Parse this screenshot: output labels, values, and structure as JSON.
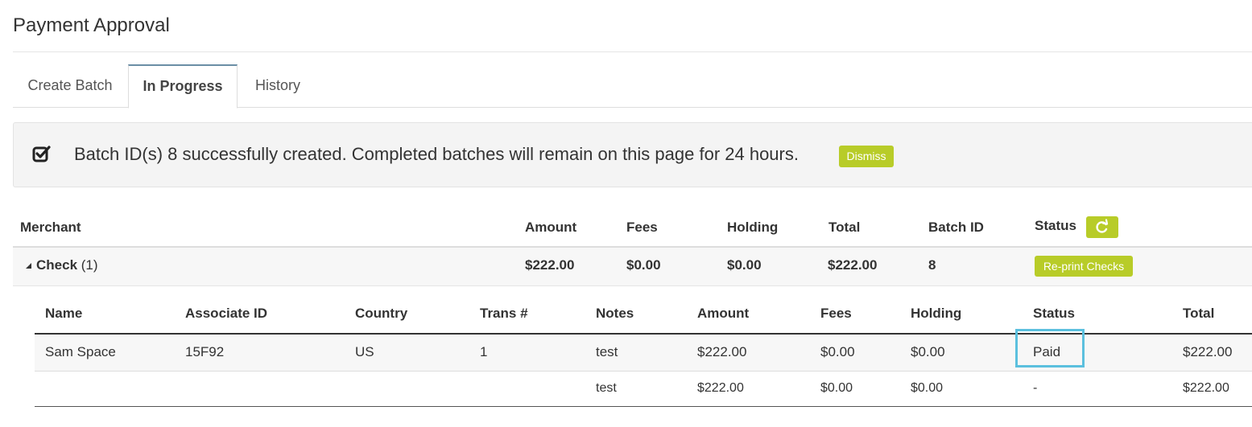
{
  "page": {
    "title": "Payment Approval"
  },
  "tabs": [
    {
      "label": "Create Batch",
      "active": false
    },
    {
      "label": "In Progress",
      "active": true
    },
    {
      "label": "History",
      "active": false
    }
  ],
  "alert": {
    "icon": "checkbox-checked-icon",
    "message": "Batch ID(s) 8 successfully created. Completed batches will remain on this page for 24 hours.",
    "dismiss_label": "Dismiss"
  },
  "batch_table": {
    "headers": {
      "merchant": "Merchant",
      "amount": "Amount",
      "fees": "Fees",
      "holding": "Holding",
      "total": "Total",
      "batch_id": "Batch ID",
      "status": "Status"
    },
    "refresh_icon": "refresh-icon",
    "row": {
      "toggle_icon": "caret-down-icon",
      "merchant": "Check",
      "count": "(1)",
      "amount": "$222.00",
      "fees": "$0.00",
      "holding": "$0.00",
      "total": "$222.00",
      "batch_id": "8",
      "action_label": "Re-print Checks"
    }
  },
  "detail_table": {
    "headers": {
      "name": "Name",
      "associate_id": "Associate ID",
      "country": "Country",
      "trans": "Trans #",
      "notes": "Notes",
      "amount": "Amount",
      "fees": "Fees",
      "holding": "Holding",
      "status": "Status",
      "total": "Total"
    },
    "rows": [
      {
        "name": "Sam Space",
        "associate_id": "15F92",
        "country": "US",
        "trans": "1",
        "notes": "test",
        "amount": "$222.00",
        "fees": "$0.00",
        "holding": "$0.00",
        "status": "Paid",
        "total": "$222.00"
      },
      {
        "name": "",
        "associate_id": "",
        "country": "",
        "trans": "",
        "notes": "test",
        "amount": "$222.00",
        "fees": "$0.00",
        "holding": "$0.00",
        "status": "-",
        "total": "$222.00"
      }
    ]
  },
  "colors": {
    "accent_green": "#b8cc28",
    "highlight_blue": "#5bc0de",
    "tab_active_top": "#6a8ea5"
  }
}
